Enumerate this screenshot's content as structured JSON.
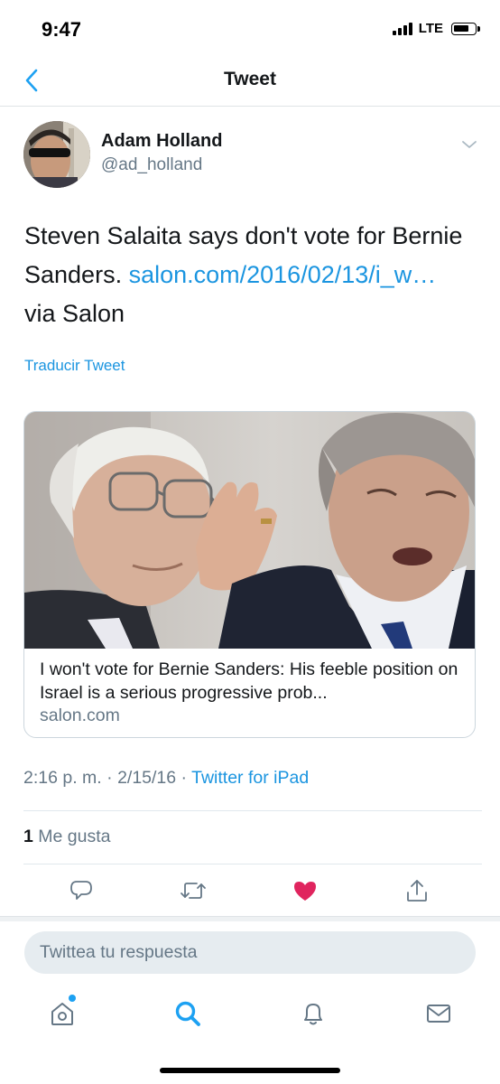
{
  "status_bar": {
    "time": "9:47",
    "network": "LTE"
  },
  "nav": {
    "title": "Tweet"
  },
  "author": {
    "name": "Adam Holland",
    "handle": "@ad_holland"
  },
  "tweet": {
    "text_before_link": "Steven Salaita says don't vote for Bernie Sanders. ",
    "link": "salon.com/2016/02/13/i_w…",
    "text_after_link": "via Salon",
    "translate_label": "Traducir Tweet"
  },
  "card": {
    "title": "I won't vote for Bernie Sanders: His feeble position on Israel is a serious progressive prob...",
    "domain": "salon.com"
  },
  "meta": {
    "time": "2:16 p. m.",
    "date": "2/15/16",
    "separator": "·",
    "source": "Twitter for iPad"
  },
  "likes": {
    "count": "1",
    "label": "Me gusta"
  },
  "actions": {
    "reply_icon": "reply-icon",
    "retweet_icon": "retweet-icon",
    "like_icon": "heart-icon",
    "share_icon": "share-icon",
    "like_color": "#e0245e",
    "liked": true
  },
  "reply": {
    "placeholder": "Twittea tu respuesta"
  },
  "tab_bar": {
    "tabs": [
      "home-icon",
      "search-icon",
      "bell-icon",
      "mail-icon"
    ],
    "active": "search-icon",
    "accent": "#1da1f2"
  },
  "colors": {
    "link": "#1b95e0",
    "secondary_text": "#657786",
    "primary_text": "#14171a"
  }
}
